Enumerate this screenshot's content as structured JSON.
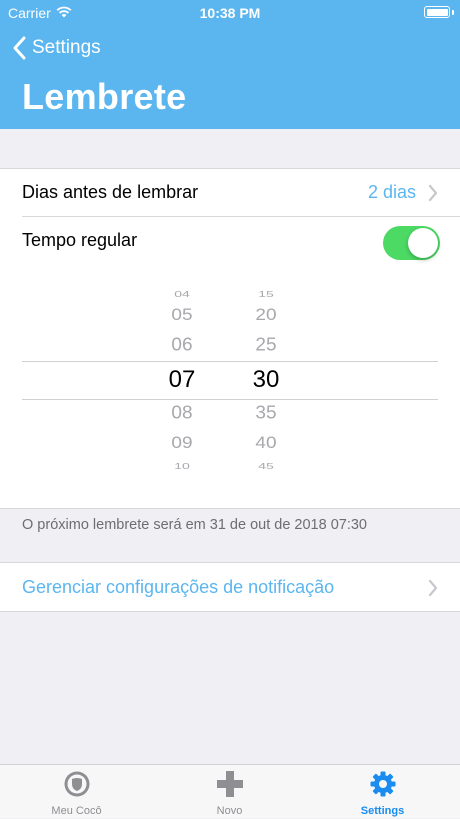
{
  "status_bar": {
    "carrier": "Carrier",
    "time": "10:38 PM"
  },
  "nav": {
    "back_label": "Settings",
    "title": "Lembrete"
  },
  "settings": {
    "days_before_label": "Dias antes de lembrar",
    "days_before_value": "2 dias",
    "regular_time_label": "Tempo regular",
    "regular_time_enabled": true
  },
  "picker": {
    "hours": [
      "04",
      "05",
      "06",
      "07",
      "08",
      "09",
      "10"
    ],
    "minutes": [
      "15",
      "20",
      "25",
      "30",
      "35",
      "40",
      "45"
    ],
    "selected_hour": "07",
    "selected_minute": "30"
  },
  "info_text": "O próximo lembrete será em 31 de out de 2018 07:30",
  "manage_notifications_label": "Gerenciar configurações de notificação",
  "tabs": [
    {
      "label": "Meu Cocô",
      "icon": "shield-icon"
    },
    {
      "label": "Novo",
      "icon": "plus-icon"
    },
    {
      "label": "Settings",
      "icon": "gear-icon",
      "active": true
    }
  ],
  "colors": {
    "accent": "#5bb6f0",
    "toggle_on": "#4cd964",
    "tab_active": "#1a8cf0"
  }
}
